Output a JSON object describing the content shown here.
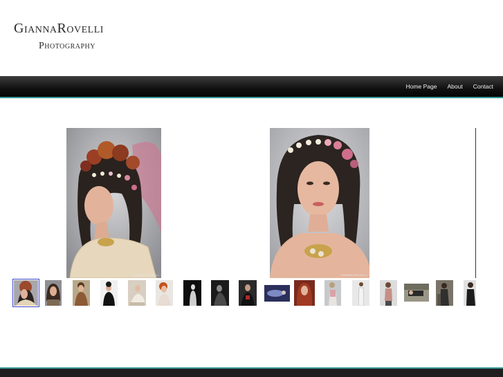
{
  "logo": {
    "line1": "GiannaRovelli",
    "line2": "Photography"
  },
  "nav": {
    "items": [
      {
        "label": "Home Page"
      },
      {
        "label": "About"
      },
      {
        "label": "Contact"
      }
    ]
  },
  "slideshow": {
    "watermark": "GIANNA ROVELLI",
    "active_thumbnail": 1,
    "thumbnail_count": 17
  },
  "colors": {
    "accent": "#3a9a9a",
    "nav_bg": "#111111",
    "active_outline": "#3b48c8"
  }
}
